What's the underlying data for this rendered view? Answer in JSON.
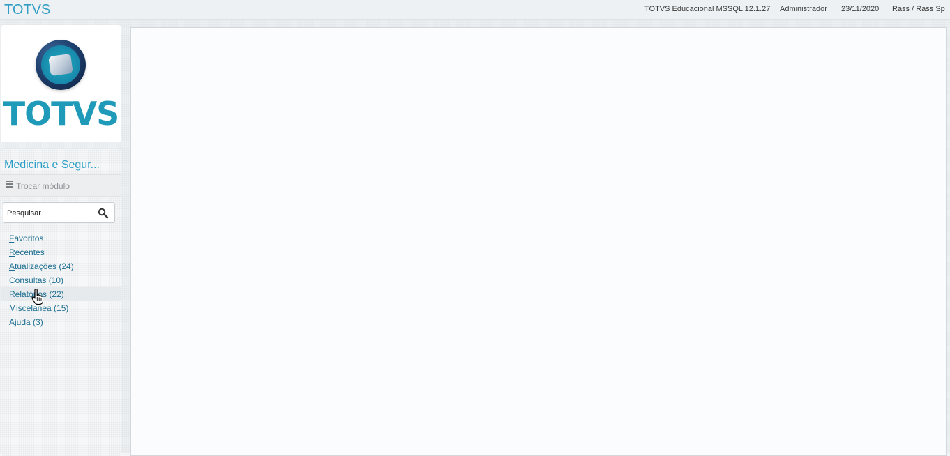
{
  "topbar": {
    "app_title": "TOTVS",
    "system": "TOTVS Educacional MSSQL 12.1.27",
    "user": "Administrador",
    "date": "23/11/2020",
    "company": "Rass / Rass Sp"
  },
  "logo": {
    "wordmark": "TOTVS"
  },
  "sidebar": {
    "module_name": "Medicina e Segur...",
    "switch_module_label": "Trocar módulo",
    "search": {
      "placeholder": "Pesquisar"
    },
    "items": [
      {
        "first": "F",
        "rest": "avoritos"
      },
      {
        "first": "R",
        "rest": "ecentes"
      },
      {
        "first": "A",
        "rest": "tualizações (24)"
      },
      {
        "first": "C",
        "rest": "onsultas (10)"
      },
      {
        "first": "R",
        "rest": "elatórios (22)"
      },
      {
        "first": "M",
        "rest": "iscelanea (15)"
      },
      {
        "first": "A",
        "rest": "juda (3)"
      }
    ]
  },
  "colors": {
    "accent": "#2b9fc6",
    "link": "#1d6e90",
    "logo_teal": "#1f9ab8",
    "logo_navy": "#1e3f6d"
  },
  "icons": {
    "search": "search-icon",
    "menu": "hamburger-icon",
    "cursor": "hand-cursor-icon"
  }
}
